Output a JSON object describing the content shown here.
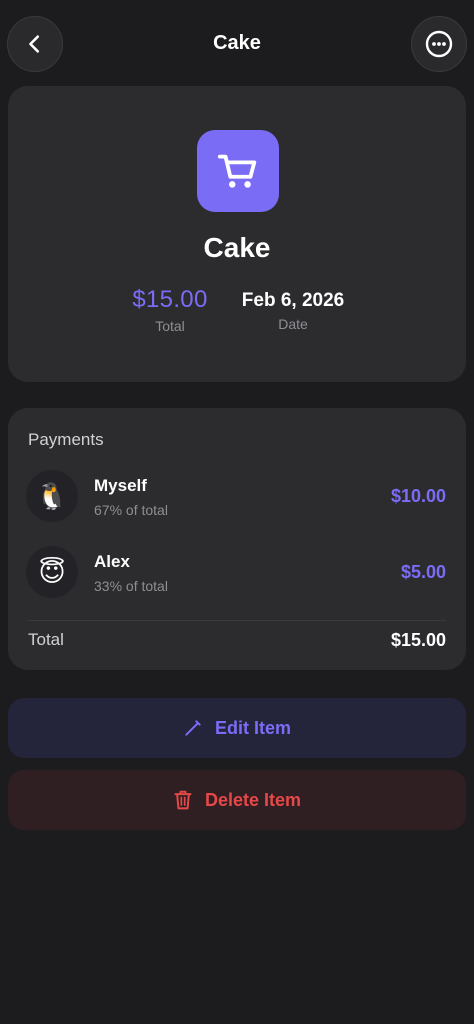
{
  "header": {
    "title": "Cake"
  },
  "item": {
    "name": "Cake",
    "amount": "$15.00",
    "amount_caption": "Total",
    "date": "Feb 6, 2026",
    "date_caption": "Date",
    "icon": "shopping-cart-icon"
  },
  "payments": {
    "title": "Payments",
    "rows": [
      {
        "name": "Myself",
        "percent_text": "67% of total",
        "amount": "$10.00",
        "avatar": "🐧"
      },
      {
        "name": "Alex",
        "percent_text": "33% of total",
        "amount": "$5.00",
        "avatar": "😇"
      }
    ],
    "total_label": "Total",
    "total_value": "$15.00"
  },
  "actions": {
    "edit_label": "Edit Item",
    "delete_label": "Delete Item"
  },
  "colors": {
    "accent": "#7b6cf6",
    "danger": "#e54848",
    "background": "#1c1c1e",
    "card": "#2c2c2f"
  }
}
